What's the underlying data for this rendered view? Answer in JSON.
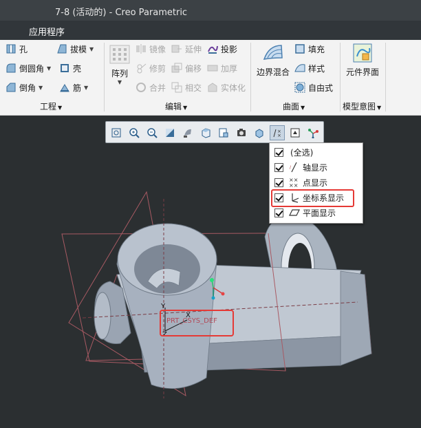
{
  "window": {
    "title": "7-8 (活动的) - Creo Parametric"
  },
  "menubar": {
    "app_menu": "应用程序"
  },
  "ribbon": {
    "engineering": {
      "hole": "孔",
      "draft": "拔模",
      "round": "倒圆角",
      "shell": "壳",
      "chamfer": "倒角",
      "rib": "筋",
      "group": "工程"
    },
    "editing": {
      "pattern": "阵列",
      "mirror": "镜像",
      "extend": "延伸",
      "project": "投影",
      "trim": "修剪",
      "offset": "偏移",
      "thicken": "加厚",
      "merge": "合并",
      "intersect": "相交",
      "solidify": "实体化",
      "group": "编辑"
    },
    "surfaces": {
      "boundary_blend": "边界混合",
      "fill": "填充",
      "style": "样式",
      "freestyle": "自由式",
      "group": "曲面"
    },
    "model_intent": {
      "component_interface": "元件界面",
      "group": "模型意图"
    }
  },
  "view_toolbar": {
    "icons": [
      "refit-icon",
      "zoom-in-icon",
      "zoom-out-icon",
      "repaint-icon",
      "display-style-icon",
      "saved-orientations-icon",
      "view-manager-icon",
      "perspective-icon",
      "spin-center-icon",
      "datum-display-filter-icon",
      "annotation-display-icon",
      "datum-toggle-icon"
    ]
  },
  "datum_dropdown": {
    "items": [
      {
        "label": "(全选)",
        "checked": true,
        "icon": ""
      },
      {
        "label": "轴显示",
        "checked": true,
        "icon": "axis-icon"
      },
      {
        "label": "点显示",
        "checked": true,
        "icon": "point-icon"
      },
      {
        "label": "坐标系显示",
        "checked": true,
        "icon": "csys-icon"
      },
      {
        "label": "平面显示",
        "checked": true,
        "icon": "plane-icon"
      }
    ],
    "highlighted": "坐标系显示"
  },
  "model": {
    "csys_label": "PRT_CSYS_DEF",
    "axis_x": "X",
    "axis_y": "Y",
    "axis_z": "Z"
  },
  "colors": {
    "highlight": "#e53935",
    "viewport_bg": "#2b2f31",
    "model_fill": "#b5bec9",
    "datum_plane": "#a85a63"
  }
}
